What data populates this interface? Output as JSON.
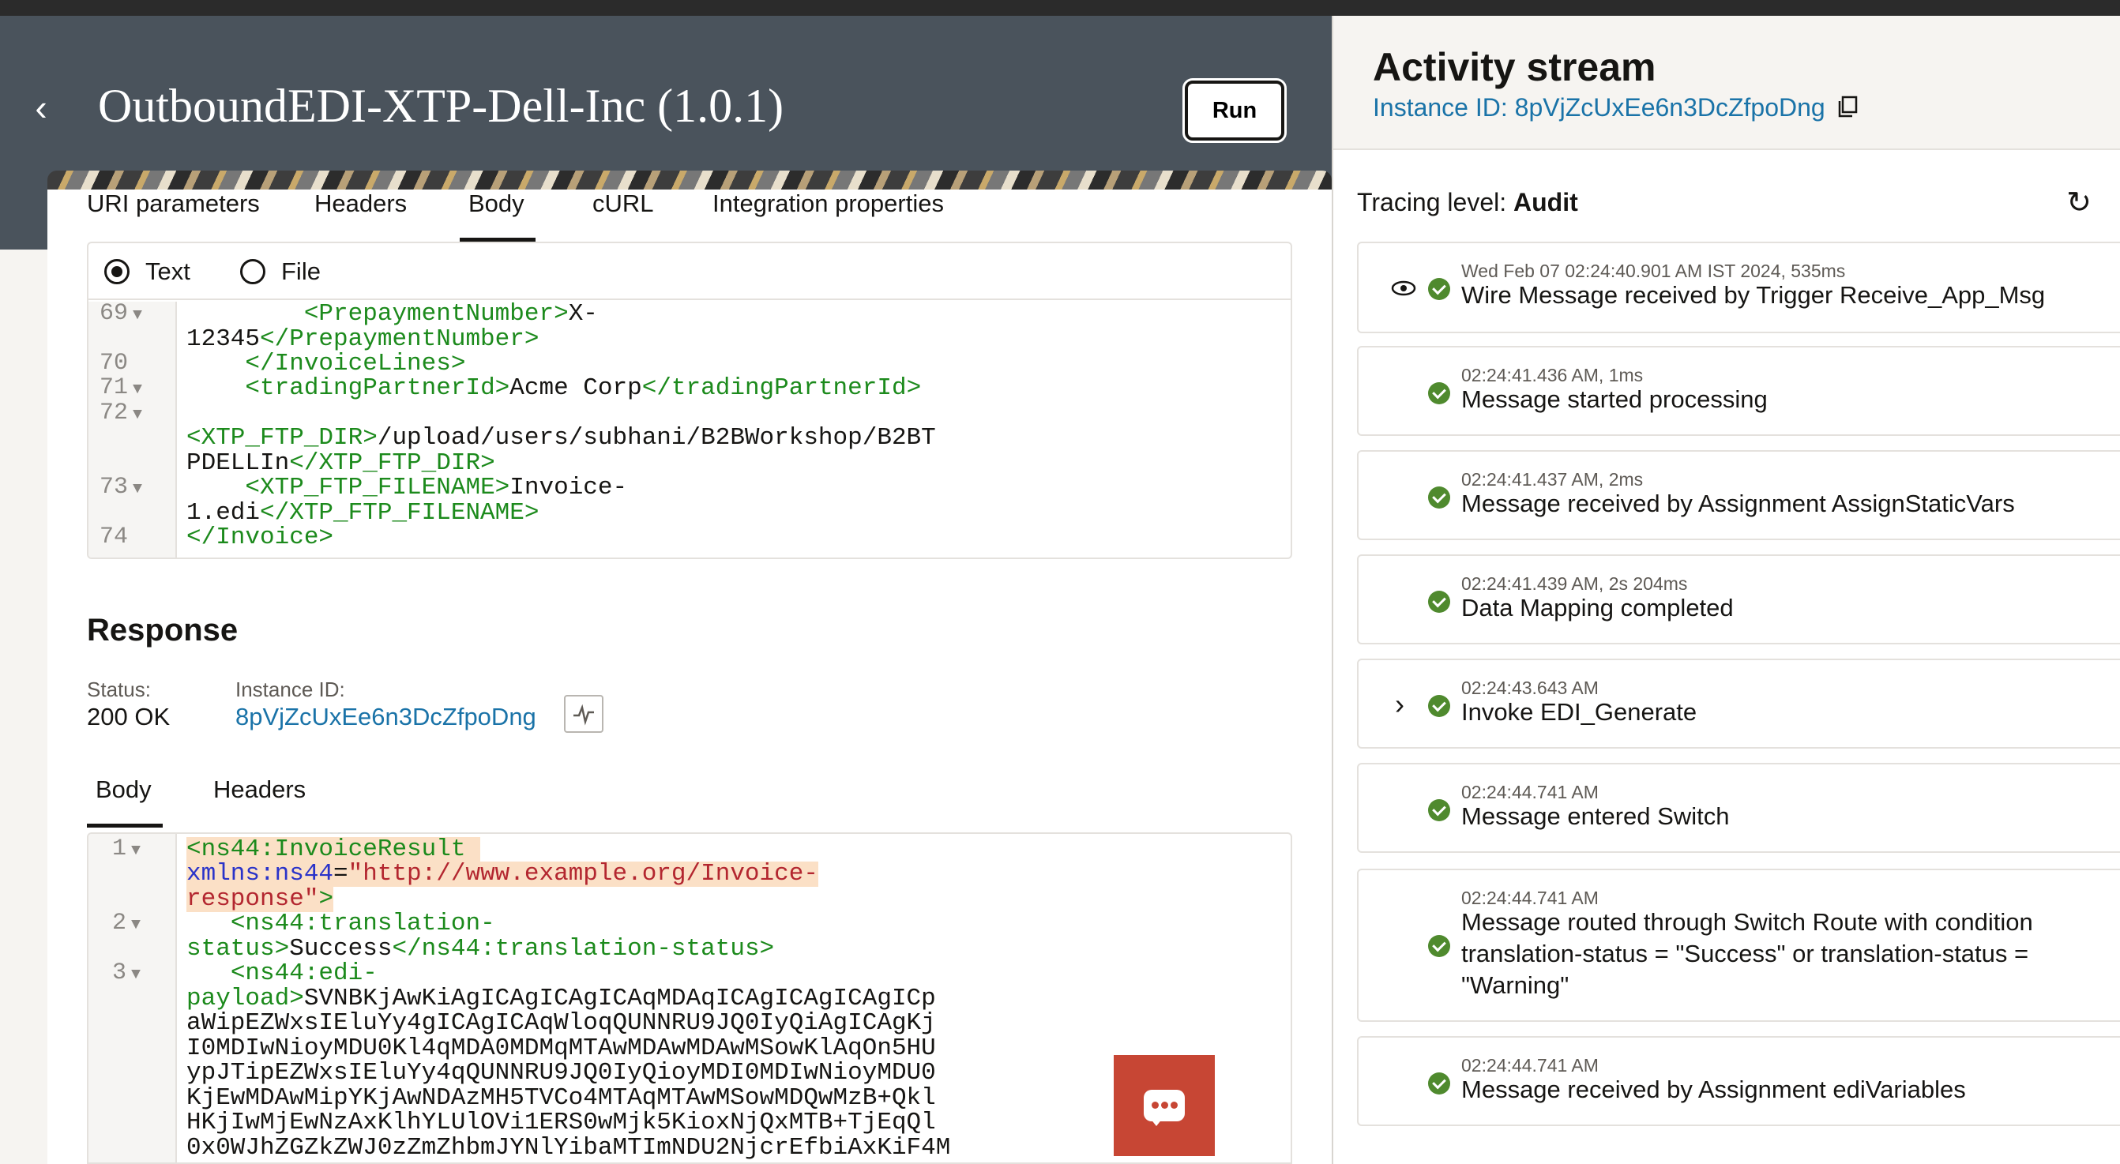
{
  "header": {
    "title": "OutboundEDI-XTP-Dell-Inc (1.0.1)",
    "back_icon": "‹",
    "run_label": "Run"
  },
  "request_tabs": [
    "URI parameters",
    "Headers",
    "Body",
    "cURL",
    "Integration properties"
  ],
  "body_format": {
    "text": "Text",
    "file": "File",
    "selected": "Text"
  },
  "request_code": {
    "line_numbers": [
      "69",
      "70",
      "71",
      "72",
      "73",
      "74"
    ],
    "lines": [
      {
        "i": "        ",
        "o": "<PrepaymentNumber>",
        "t": "X-",
        "c": ""
      },
      {
        "i": "",
        "o": "",
        "t": "12345",
        "c": "</PrepaymentNumber>"
      },
      {
        "i": "    ",
        "o": "",
        "t": "",
        "c": "</InvoiceLines>"
      },
      {
        "i": "    ",
        "o": "<tradingPartnerId>",
        "t": "Acme Corp",
        "c": "</tradingPartnerId>"
      },
      {
        "i": "",
        "o": "",
        "t": "",
        "c": ""
      },
      {
        "i": "",
        "o": "<XTP_FTP_DIR>",
        "t": "/upload/users/subhani/B2BWorkshop/B2BT",
        "c": ""
      },
      {
        "i": "",
        "o": "",
        "t": "PDELLIn",
        "c": "</XTP_FTP_DIR>"
      },
      {
        "i": "    ",
        "o": "<XTP_FTP_FILENAME>",
        "t": "Invoice-",
        "c": ""
      },
      {
        "i": "",
        "o": "",
        "t": "1.edi",
        "c": "</XTP_FTP_FILENAME>"
      },
      {
        "i": "",
        "o": "",
        "t": "",
        "c": "</Invoice>"
      }
    ]
  },
  "response": {
    "heading": "Response",
    "status_label": "Status:",
    "status_value": "200 OK",
    "instance_label": "Instance ID:",
    "instance_value": "8pVjZcUxEe6n3DcZfpoDng",
    "activity_icon": "activity-stream-icon",
    "tabs": [
      "Body",
      "Headers"
    ],
    "code": {
      "line_numbers": [
        "1",
        "2",
        "3"
      ],
      "l1a": "<ns44:InvoiceResult",
      "l1b_attr": "xmlns:ns44",
      "l1b_eq": "=",
      "l1b_str": "\"http://www.example.org/Invoice-",
      "l1c_str": "response\"",
      "l1c_gt": ">",
      "l2a": "<ns44:translation-",
      "l2b_tag": "status>",
      "l2b_text": "Success",
      "l2b_close": "</ns44:translation-status>",
      "l3a": "<ns44:edi-",
      "l3b_tag": "payload>",
      "payload": [
        "SVNBKjAwKiAgICAgICAgICAqMDAqICAgICAgICAgICp",
        "aWipEZWxsIEluYy4gICAgICAqWloqQUNNRU9JQ0IyQiAgICAgKj",
        "I0MDIwNioyMDU0Kl4qMDA0MDMqMTAwMDAwMDAwMSowKlAqOn5HU",
        "ypJTipEZWxsIEluYy4qQUNNRU9JQ0IyQioyMDI0MDIwNioyMDU0",
        "KjEwMDAwMipYKjAwNDAzMH5TVCo4MTAqMTAwMSowMDQwMzB+Qkl",
        "HKjIwMjEwNzAxKlhYLUlOVi1ERS0wMjk5KioxNjQxMTB+TjEqQl",
        "0x0WJhZGZkZWJ0zZmZhbmJYNlYibaMTImNDU2NjcrEfbiAxKiF4M"
      ]
    }
  },
  "activity": {
    "title": "Activity stream",
    "instance_text": "Instance ID: 8pVjZcUxEe6n3DcZfpoDng",
    "tracing_label": "Tracing level:",
    "tracing_value": "Audit",
    "refresh_icon": "↻",
    "items": [
      {
        "ts": "Wed Feb 07 02:24:40.901 AM IST 2024, 535ms",
        "msg": "Wire Message received by Trigger Receive_App_Msg",
        "icon": "eye-icon"
      },
      {
        "ts": "02:24:41.436 AM, 1ms",
        "msg": "Message started processing"
      },
      {
        "ts": "02:24:41.437 AM, 2ms",
        "msg": "Message received by Assignment AssignStaticVars"
      },
      {
        "ts": "02:24:41.439 AM, 2s 204ms",
        "msg": "Data Mapping completed"
      },
      {
        "ts": "02:24:43.643 AM",
        "msg": "Invoke EDI_Generate",
        "icon": "chevron-right-icon"
      },
      {
        "ts": "02:24:44.741 AM",
        "msg": "Message entered Switch"
      },
      {
        "ts": "02:24:44.741 AM",
        "msg": "Message routed through Switch Route with condition translation-status = \"Success\" or translation-status = \"Warning\""
      },
      {
        "ts": "02:24:44.741 AM",
        "msg": "Message received by Assignment ediVariables"
      }
    ]
  },
  "colors": {
    "header_bg": "#4a535c",
    "link": "#1a73a8",
    "success": "#4f8a2e",
    "chat": "#c74634",
    "xml_tag": "#1c8a1c"
  }
}
